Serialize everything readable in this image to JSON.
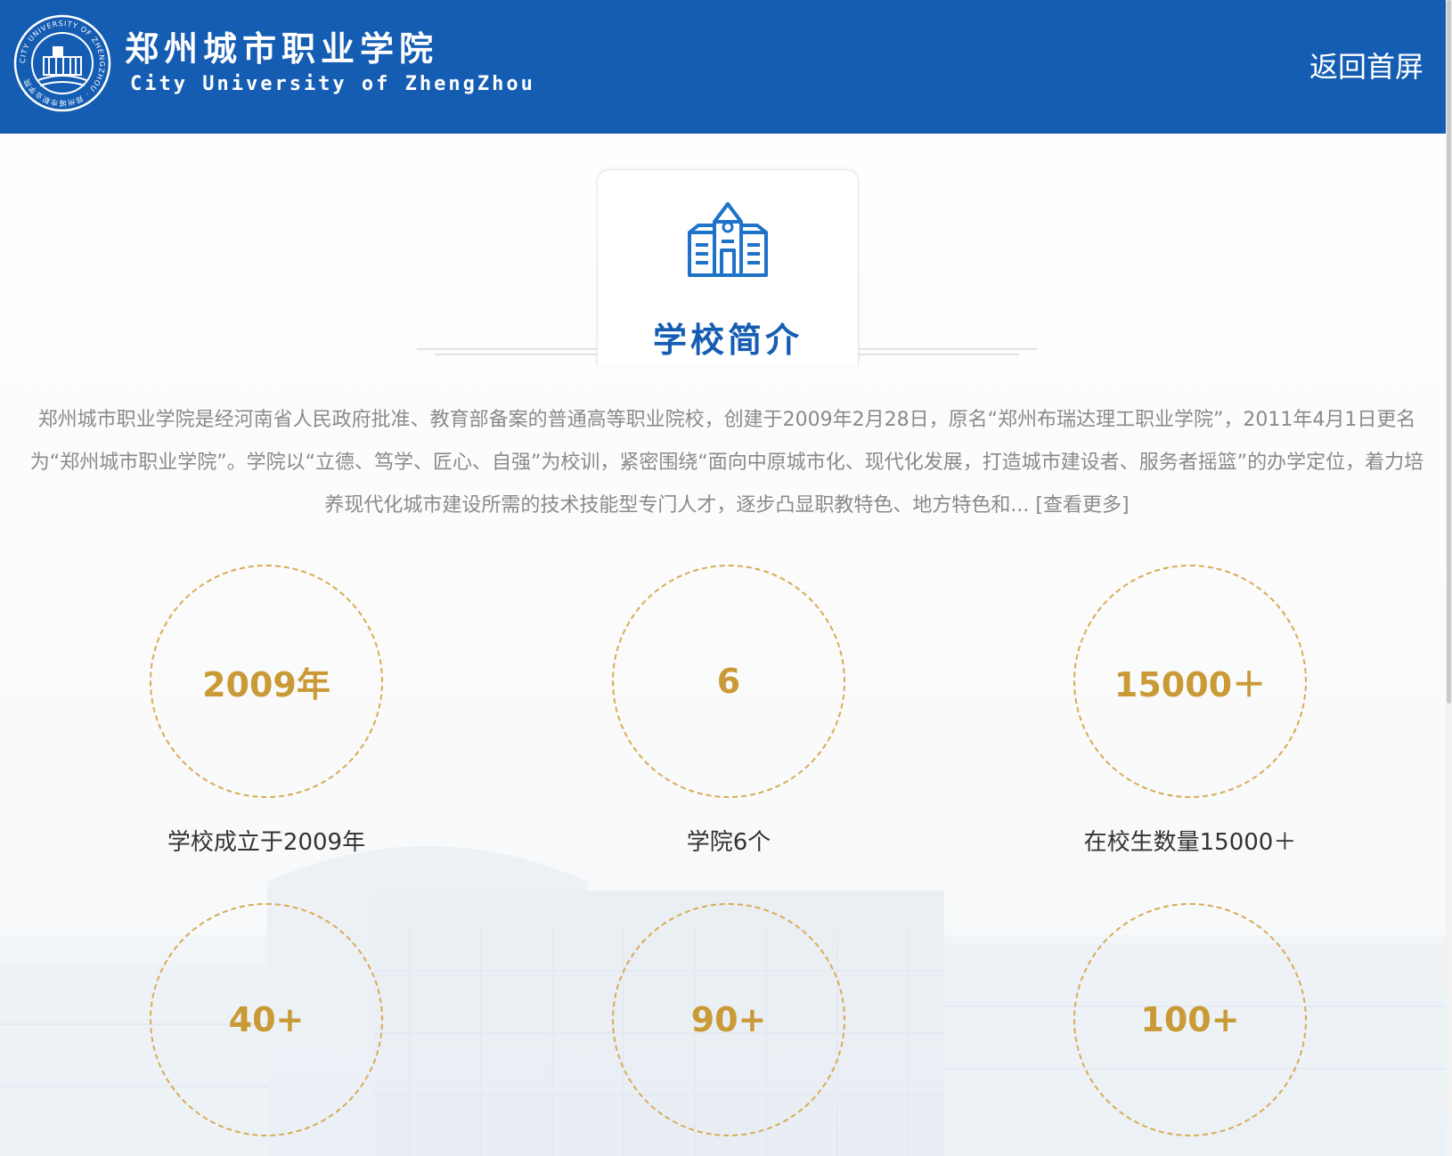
{
  "header": {
    "title_cn": "郑州城市职业学院",
    "title_en": "City University of ZhengZhou",
    "back_link": "返回首屏",
    "seal_text": "CITY UNIVERSITY OF ZHENGZHOU · 郑州城市职业学院"
  },
  "section": {
    "title": "学校简介",
    "icon": "school-building-icon"
  },
  "intro": {
    "text": "郑州城市职业学院是经河南省人民政府批准、教育部备案的普通高等职业院校，创建于2009年2月28日，原名“郑州布瑞达理工职业学院”，2011年4月1日更名为“郑州城市职业学院”。学院以“立德、笃学、匠心、自强”为校训，紧密围绕“面向中原城市化、现代化发展，打造城市建设者、服务者摇篮”的办学定位，着力培养现代化城市建设所需的技术技能型专门人才，逐步凸显职教特色、地方特色和...",
    "more_link": "[查看更多]"
  },
  "stats": [
    {
      "value": "2009年",
      "label": "学校成立于2009年"
    },
    {
      "value": "6",
      "label": "学院6个"
    },
    {
      "value": "15000＋",
      "label": "在校生数量15000＋"
    },
    {
      "value": "40+",
      "label": ""
    },
    {
      "value": "90+",
      "label": ""
    },
    {
      "value": "100+",
      "label": ""
    }
  ],
  "colors": {
    "brand_blue": "#155db3",
    "gold": "#c99a35",
    "gold_border": "#d7ac55",
    "text_gray": "#8a8a8a"
  }
}
